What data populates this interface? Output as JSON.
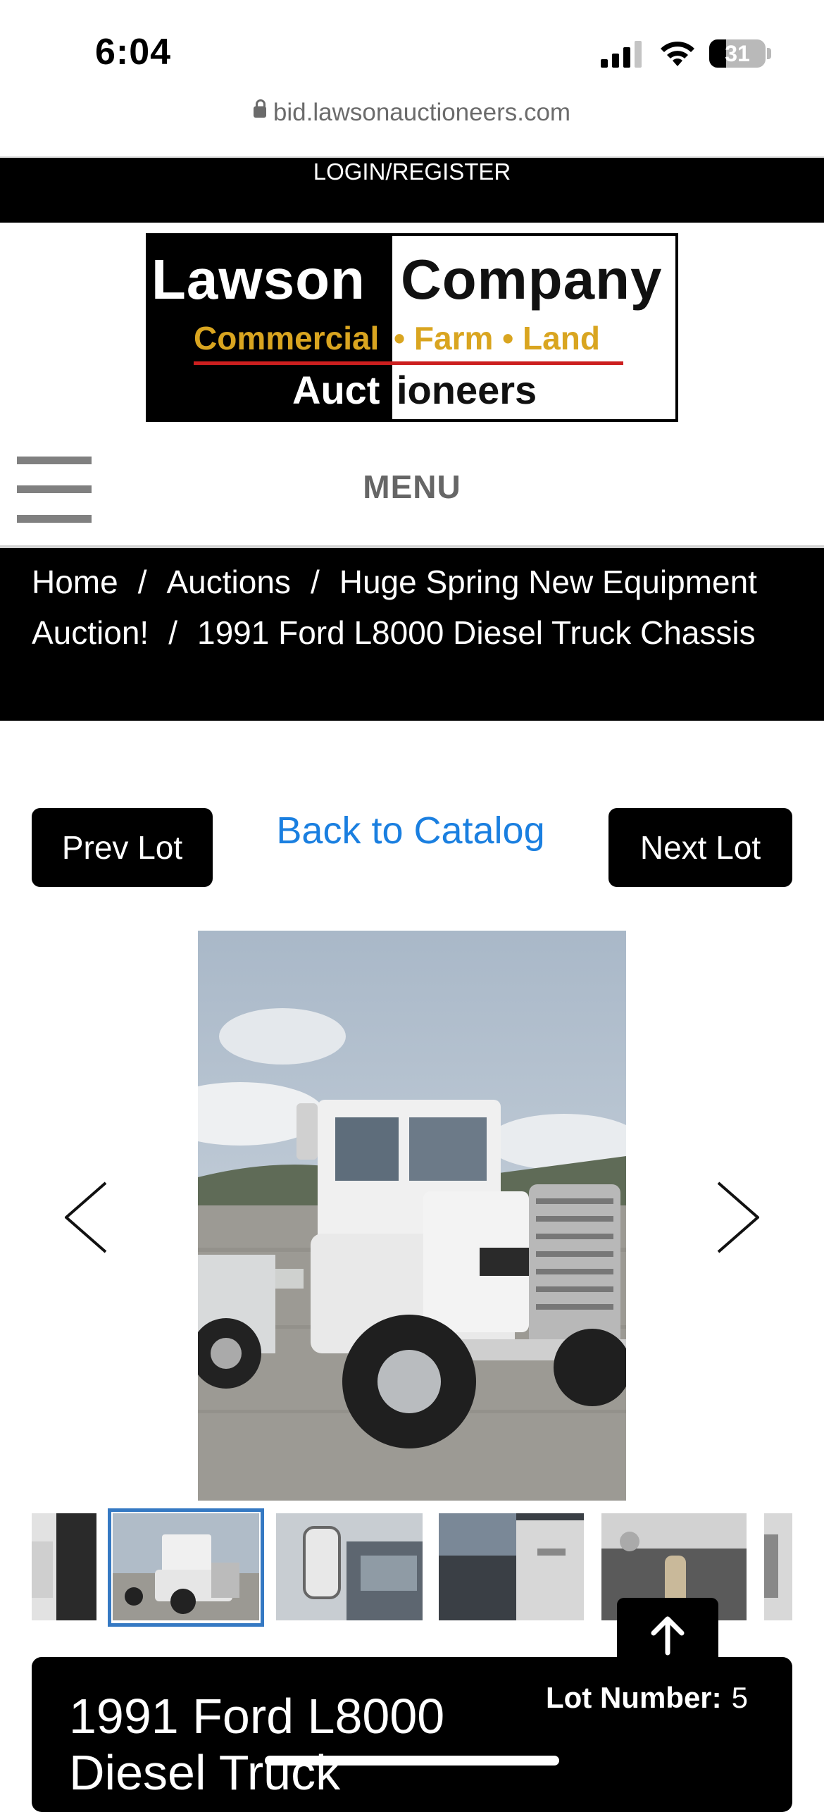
{
  "status_bar": {
    "time": "6:04",
    "battery": "31"
  },
  "browser": {
    "url": "bid.lawsonauctioneers.com"
  },
  "header": {
    "login_label": "LOGIN/REGISTER"
  },
  "logo": {
    "line1_left": "Lawson",
    "line1_right": "Company",
    "line2_left": "Commercial",
    "line2_right": "• Farm • Land",
    "line3_left": "Auct",
    "line3_right": "ioneers"
  },
  "menu": {
    "label": "MENU"
  },
  "breadcrumb": {
    "items": [
      "Home",
      "Auctions",
      "Huge Spring New Equipment Auction!",
      "1991 Ford L8000 Diesel Truck Chassis"
    ],
    "separator": "/"
  },
  "lot_nav": {
    "prev_label": "Prev Lot",
    "back_label": "Back to Catalog",
    "next_label": "Next Lot"
  },
  "lot": {
    "title": "1991 Ford L8000 Diesel Truck",
    "number_label": "Lot Number:",
    "number": "5"
  },
  "colors": {
    "link_blue": "#1a7fe0",
    "thumb_selected_border": "#3579c3",
    "logo_gold": "#d9a520",
    "logo_red": "#cc1f1f"
  },
  "icons": [
    "lock-icon",
    "hamburger-menu-icon",
    "chevron-left-icon",
    "chevron-right-icon",
    "arrow-up-icon",
    "signal-icon",
    "wifi-icon",
    "battery-icon"
  ]
}
